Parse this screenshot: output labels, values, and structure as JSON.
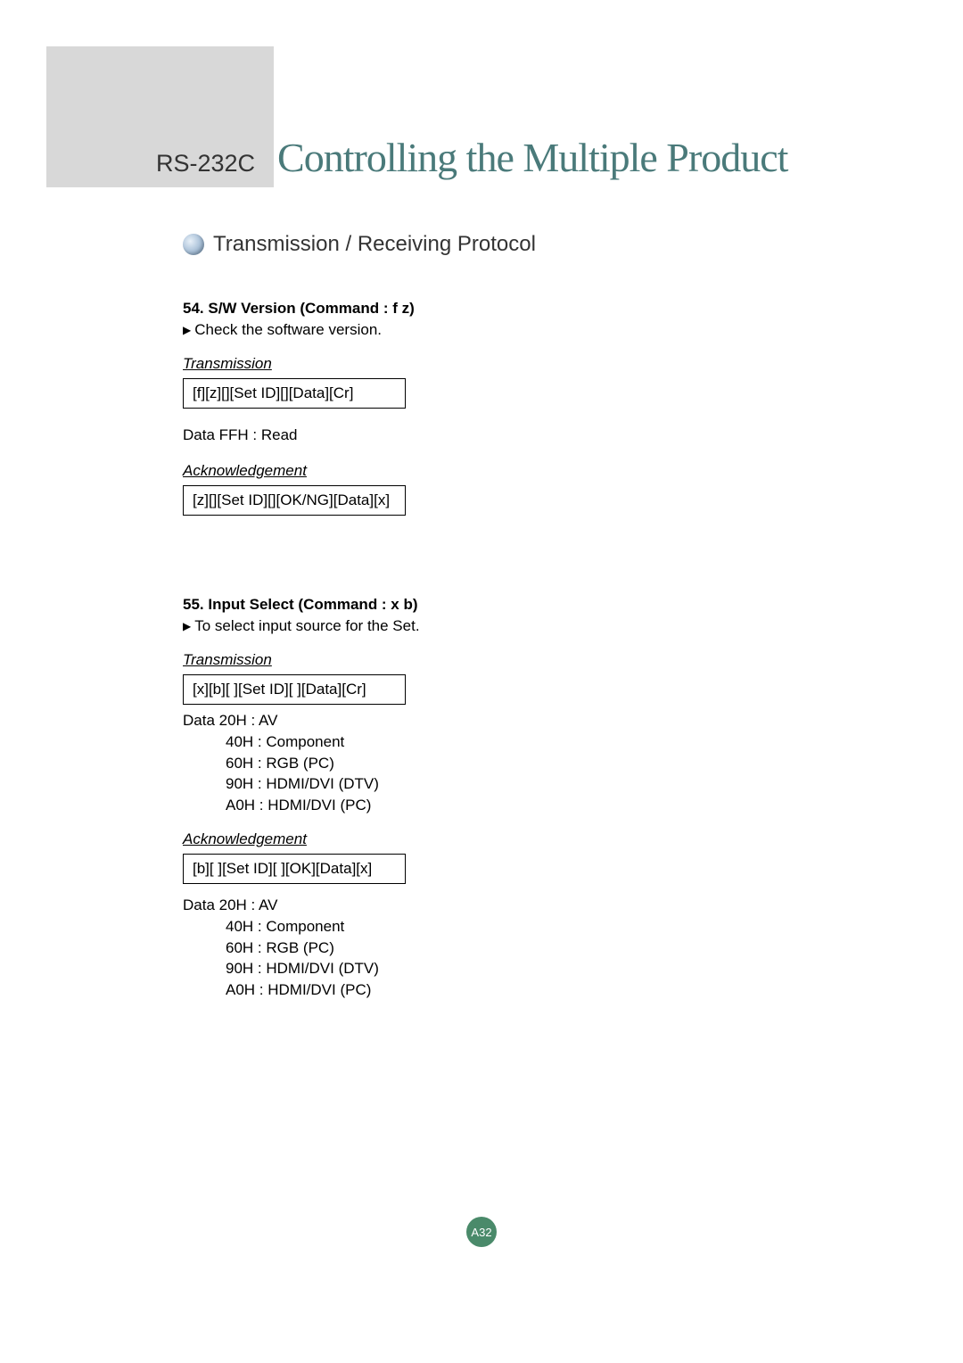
{
  "header": {
    "prefix": "RS-232C",
    "title": "Controlling the Multiple Product"
  },
  "section_heading": "Transmission / Receiving Protocol",
  "commands": [
    {
      "title": "54. S/W Version (Command : f z)",
      "description": "Check the software version.",
      "transmission_label": "Transmission",
      "transmission_code": "[f][z][][Set ID][][Data][Cr]",
      "data_note": "Data FFH : Read",
      "ack_label": "Acknowledgement",
      "ack_code": "[z][][Set ID][][OK/NG][Data][x]"
    },
    {
      "title": "55. Input Select (Command : x b)",
      "description": "To select input source for the Set.",
      "transmission_label": "Transmission",
      "transmission_code": "[x][b][ ][Set ID][ ][Data][Cr]",
      "tx_data_prefix": "Data  20H : AV",
      "tx_data_lines": [
        "40H : Component",
        "60H : RGB (PC)",
        "90H : HDMI/DVI (DTV)",
        "A0H : HDMI/DVI (PC)"
      ],
      "ack_label": "Acknowledgement",
      "ack_code": "[b][ ][Set ID][ ][OK][Data][x]",
      "ack_data_prefix": "Data  20H : AV",
      "ack_data_lines": [
        "40H : Component",
        " 60H : RGB (PC)",
        "90H : HDMI/DVI (DTV)",
        "A0H : HDMI/DVI (PC)"
      ]
    }
  ],
  "page_number": "A32"
}
